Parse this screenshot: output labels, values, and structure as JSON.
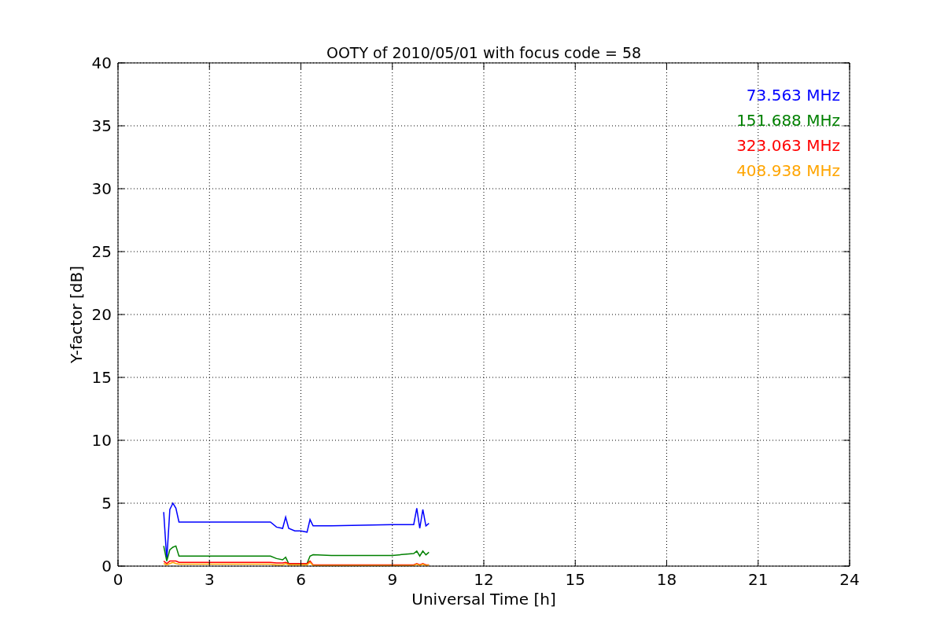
{
  "chart_data": {
    "type": "line",
    "title": "OOTY of 2010/05/01 with focus code = 58",
    "xlabel": "Universal Time [h]",
    "ylabel": "Y-factor [dB]",
    "x": [
      1.5,
      1.6,
      1.7,
      1.8,
      1.9,
      2.0,
      3,
      4,
      5,
      5.2,
      5.4,
      5.5,
      5.6,
      5.8,
      6.0,
      6.2,
      6.3,
      6.4,
      7,
      8,
      9,
      9.7,
      9.8,
      9.9,
      10.0,
      10.1,
      10.2
    ],
    "series": [
      {
        "name": "73.563 MHz",
        "color": "#0000ff",
        "values": [
          4.3,
          0.5,
          4.5,
          5.0,
          4.6,
          3.5,
          3.5,
          3.5,
          3.5,
          3.1,
          3.0,
          3.9,
          3.0,
          2.8,
          2.8,
          2.7,
          3.7,
          3.2,
          3.2,
          3.25,
          3.3,
          3.3,
          4.6,
          3.0,
          4.5,
          3.2,
          3.4
        ]
      },
      {
        "name": "151.688 MHz",
        "color": "#008000",
        "values": [
          1.6,
          0.4,
          1.3,
          1.5,
          1.6,
          0.8,
          0.8,
          0.8,
          0.8,
          0.6,
          0.5,
          0.7,
          0.2,
          0.2,
          0.2,
          0.2,
          0.8,
          0.9,
          0.85,
          0.85,
          0.85,
          1.0,
          1.2,
          0.8,
          1.2,
          0.9,
          1.1
        ]
      },
      {
        "name": "323.063 MHz",
        "color": "#ff0000",
        "values": [
          0.4,
          0.2,
          0.4,
          0.4,
          0.4,
          0.3,
          0.3,
          0.3,
          0.3,
          0.25,
          0.25,
          0.3,
          0.2,
          0.2,
          0.2,
          0.2,
          0.4,
          0.1,
          0.1,
          0.1,
          0.1,
          0.1,
          0.2,
          0.1,
          0.2,
          0.1,
          0.1
        ]
      },
      {
        "name": "408.938 MHz",
        "color": "#ffa500",
        "values": [
          0.2,
          0.1,
          0.2,
          0.3,
          0.2,
          0.15,
          0.15,
          0.15,
          0.15,
          0.1,
          0.1,
          0.2,
          0.1,
          0.1,
          0.1,
          0.1,
          0.3,
          0.05,
          0.05,
          0.05,
          0.05,
          0.05,
          0.15,
          0.05,
          0.15,
          0.05,
          0.1
        ]
      }
    ],
    "grid": true,
    "xlim": [
      0,
      24
    ],
    "ylim": [
      0,
      40
    ],
    "xticks": [
      0,
      3,
      6,
      9,
      12,
      15,
      18,
      21,
      24
    ],
    "yticks": [
      0,
      5,
      10,
      15,
      20,
      25,
      30,
      35,
      40
    ]
  }
}
